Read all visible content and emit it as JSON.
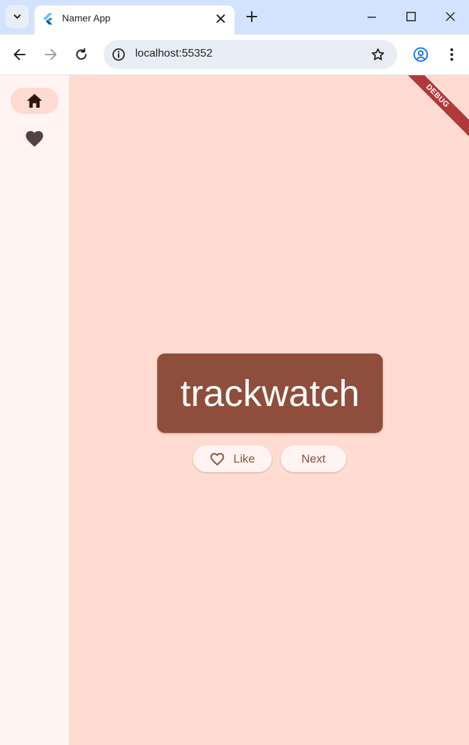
{
  "browser": {
    "tab_title": "Namer App",
    "url": "localhost:55352"
  },
  "rail": {
    "items": [
      {
        "icon": "home-icon",
        "selected": true
      },
      {
        "icon": "favorite-icon",
        "selected": false
      }
    ]
  },
  "main": {
    "word": "trackwatch",
    "like_label": "Like",
    "next_label": "Next",
    "debug_banner": "DEBUG"
  },
  "colors": {
    "accent": "#8f4e3b",
    "background": "#ffdbd2",
    "rail_background": "#fff4f2",
    "debug_ribbon": "#b03a3a"
  }
}
